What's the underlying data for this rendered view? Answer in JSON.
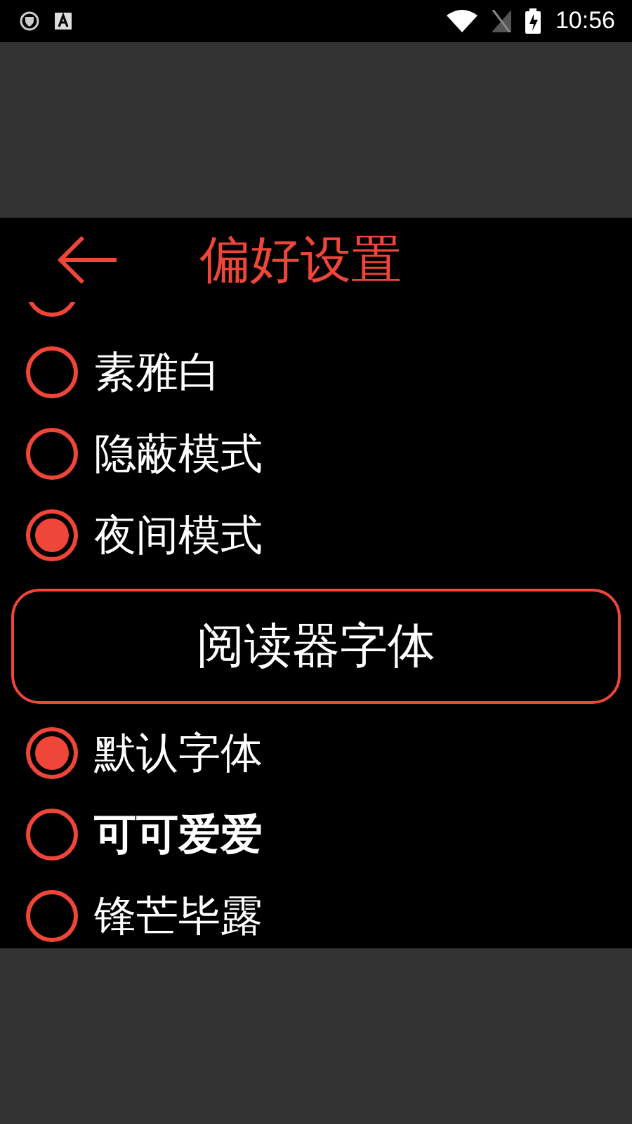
{
  "status_bar": {
    "time": "10:56"
  },
  "dialog": {
    "title": "偏好设置",
    "themes": [
      {
        "selected": false
      },
      {
        "label": "素雅白",
        "selected": false
      },
      {
        "label": "隐蔽模式",
        "selected": false
      },
      {
        "label": "夜间模式",
        "selected": true
      }
    ],
    "font_section_button": "阅读器字体",
    "fonts": [
      {
        "label": "默认字体",
        "selected": true
      },
      {
        "label": "可可爱爱",
        "selected": false
      },
      {
        "label": "锋芒毕露",
        "selected": false
      }
    ]
  }
}
